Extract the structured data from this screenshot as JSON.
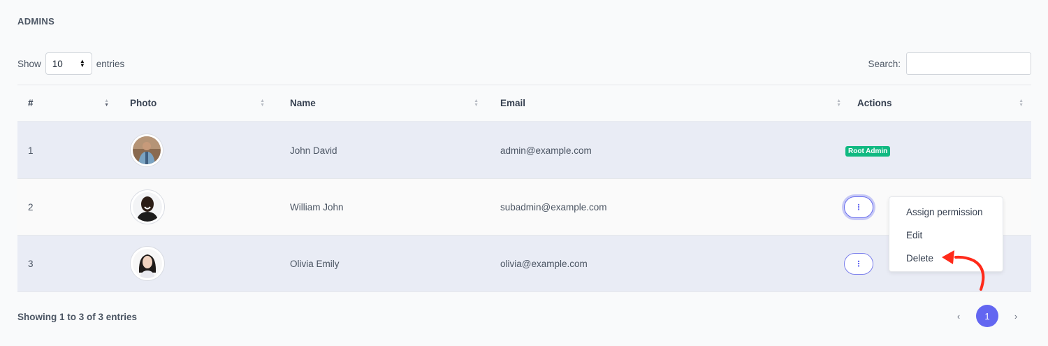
{
  "page": {
    "title": "ADMINS"
  },
  "length": {
    "prefix": "Show",
    "value": "10",
    "suffix": "entries"
  },
  "search": {
    "label": "Search:",
    "value": "",
    "placeholder": ""
  },
  "columns": [
    "#",
    "Photo",
    "Name",
    "Email",
    "Actions"
  ],
  "rows": [
    {
      "num": "1",
      "name": "John David",
      "email": "admin@example.com",
      "photo": "man-photo",
      "action": "badge",
      "badge": "Root Admin"
    },
    {
      "num": "2",
      "name": "William John",
      "email": "subadmin@example.com",
      "photo": "man-photo",
      "action": "menu"
    },
    {
      "num": "3",
      "name": "Olivia Emily",
      "email": "olivia@example.com",
      "photo": "woman-photo",
      "action": "menu"
    }
  ],
  "actions_menu": {
    "items": [
      "Assign permission",
      "Edit",
      "Delete"
    ]
  },
  "icons": {
    "kebab": "more-vertical-icon",
    "arrow": "red-curved-arrow-icon",
    "sort": "sort-icon"
  },
  "footer": {
    "info": "Showing 1 to 3 of 3 entries"
  },
  "pagination": {
    "prev": "‹",
    "current": "1",
    "next": "›"
  },
  "colors": {
    "accent": "#6366f1",
    "badge": "#10b981",
    "arrow": "#ff2a1a",
    "stripe": "#e9ecf5"
  }
}
